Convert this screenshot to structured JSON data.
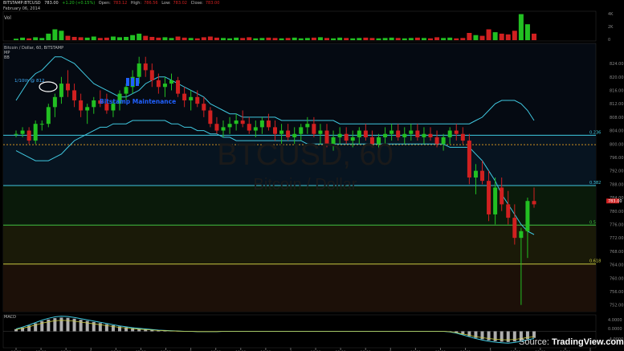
{
  "header": {
    "symbol": "BITSTAMP:BTCUSD",
    "last": "783.00",
    "change": "+1.20 (+0.15%)",
    "open_label": "Open:",
    "open": "783.12",
    "high_label": "High:",
    "high": "786.56",
    "low_label": "Low:",
    "low": "783.02",
    "close_label": "Close:",
    "close": "783.00",
    "date": "February 06, 2014"
  },
  "panes": {
    "vol_label": "Vol",
    "main_label": "Bitcoin / Dollar, 60, BITSTAMP",
    "mp_label": "MP",
    "bb_label": "BB",
    "macd_label": "MACD"
  },
  "watermark": {
    "line1": "BTCUSD, 60",
    "line2": "Bitcoin / Dollar"
  },
  "annotations": {
    "high_note": "1/10th @ 812",
    "maintenance": "Bitstamp Maintenance",
    "maintenance_icon": "bar-chart-icon"
  },
  "source": {
    "prefix": "Source:",
    "brand": "TradingView.com"
  },
  "colors": {
    "up": "#22c022",
    "down": "#d02020",
    "band": "#40c8e0",
    "macd": "#40c8e0",
    "signal": "#c8c840",
    "price_tag": "#d02020"
  },
  "chart_data": {
    "type": "candlestick",
    "x_axis_labels": [
      "06:00",
      "12:00",
      "18:00",
      "2",
      "06:00",
      "12:00",
      "18:00",
      "3",
      "06:00",
      "12:00",
      "18:00",
      "4",
      "06:00",
      "12:00",
      "18:00",
      "5",
      "06:00",
      "12:00",
      "18:00",
      "6",
      "06:00",
      "12:00",
      "18:00",
      "7"
    ],
    "price_axis": {
      "ylim": [
        750,
        830
      ],
      "tick_labels": [
        "824.00",
        "820.00",
        "816.00",
        "812.00",
        "808.00",
        "804.00",
        "800.00",
        "796.00",
        "792.00",
        "788.00",
        "784.00",
        "780.00",
        "776.00",
        "772.00",
        "768.00",
        "764.00",
        "760.00",
        "756.00",
        "752.00"
      ]
    },
    "last_price_label": "783.00",
    "fib_levels": [
      {
        "label": "0.236",
        "value": 802.6,
        "color": "#40c8e0"
      },
      {
        "label": "0.382",
        "value": 787.6,
        "color": "#40c8e0"
      },
      {
        "label": "0.5",
        "value": 775.8,
        "color": "#40c040"
      },
      {
        "label": "0.618",
        "value": 764.2,
        "color": "#c8c840"
      }
    ],
    "ma_line_value": 799.8,
    "volume_axis": {
      "tick_labels": [
        "4K",
        "2K",
        "0"
      ],
      "ylim": [
        0,
        4000
      ]
    },
    "macd_axis": {
      "tick_labels": [
        "4.0000",
        "0.0000",
        "-4.0000"
      ],
      "ylim": [
        -6,
        6
      ]
    },
    "candles": [
      [
        803,
        804,
        802,
        803
      ],
      [
        803,
        805,
        802,
        804
      ],
      [
        804,
        805,
        800,
        801
      ],
      [
        801,
        807,
        800,
        806
      ],
      [
        806,
        807,
        804,
        806
      ],
      [
        806,
        812,
        805,
        811
      ],
      [
        811,
        815,
        808,
        814
      ],
      [
        814,
        820,
        812,
        818
      ],
      [
        818,
        822,
        814,
        816
      ],
      [
        816,
        818,
        811,
        813
      ],
      [
        813,
        815,
        808,
        810
      ],
      [
        810,
        812,
        806,
        811
      ],
      [
        811,
        814,
        809,
        813
      ],
      [
        813,
        816,
        811,
        812
      ],
      [
        812,
        815,
        809,
        810
      ],
      [
        810,
        813,
        808,
        812
      ],
      [
        812,
        816,
        810,
        815
      ],
      [
        815,
        818,
        813,
        817
      ],
      [
        817,
        822,
        815,
        820
      ],
      [
        820,
        826,
        818,
        824
      ],
      [
        824,
        826,
        820,
        822
      ],
      [
        822,
        824,
        817,
        819
      ],
      [
        819,
        821,
        815,
        817
      ],
      [
        817,
        820,
        814,
        818
      ],
      [
        818,
        821,
        816,
        819
      ],
      [
        819,
        820,
        814,
        815
      ],
      [
        815,
        817,
        811,
        813
      ],
      [
        813,
        816,
        810,
        814
      ],
      [
        814,
        816,
        811,
        812
      ],
      [
        812,
        814,
        808,
        810
      ],
      [
        810,
        811,
        805,
        806
      ],
      [
        806,
        808,
        803,
        804
      ],
      [
        804,
        807,
        802,
        805
      ],
      [
        805,
        808,
        803,
        806
      ],
      [
        806,
        809,
        804,
        807
      ],
      [
        807,
        810,
        805,
        806
      ],
      [
        806,
        808,
        803,
        804
      ],
      [
        804,
        807,
        802,
        805
      ],
      [
        805,
        808,
        803,
        807
      ],
      [
        807,
        809,
        804,
        805
      ],
      [
        805,
        807,
        801,
        803
      ],
      [
        803,
        806,
        800,
        804
      ],
      [
        804,
        806,
        801,
        802
      ],
      [
        802,
        805,
        800,
        803
      ],
      [
        803,
        806,
        801,
        805
      ],
      [
        805,
        808,
        803,
        806
      ],
      [
        806,
        808,
        802,
        803
      ],
      [
        803,
        806,
        800,
        804
      ],
      [
        804,
        806,
        799,
        800
      ],
      [
        800,
        804,
        798,
        802
      ],
      [
        802,
        805,
        800,
        803
      ],
      [
        803,
        805,
        800,
        801
      ],
      [
        801,
        804,
        799,
        802
      ],
      [
        802,
        805,
        800,
        804
      ],
      [
        804,
        806,
        801,
        802
      ],
      [
        802,
        804,
        799,
        800
      ],
      [
        800,
        803,
        798,
        802
      ],
      [
        802,
        805,
        800,
        803
      ],
      [
        803,
        806,
        801,
        804
      ],
      [
        804,
        806,
        801,
        802
      ],
      [
        802,
        805,
        800,
        803
      ],
      [
        803,
        806,
        801,
        804
      ],
      [
        804,
        806,
        801,
        802
      ],
      [
        802,
        805,
        800,
        803
      ],
      [
        803,
        805,
        801,
        802
      ],
      [
        802,
        804,
        799,
        800
      ],
      [
        800,
        803,
        798,
        802
      ],
      [
        802,
        805,
        800,
        804
      ],
      [
        804,
        806,
        801,
        803
      ],
      [
        803,
        805,
        800,
        801
      ],
      [
        801,
        803,
        788,
        790
      ],
      [
        790,
        794,
        785,
        792
      ],
      [
        792,
        795,
        788,
        789
      ],
      [
        789,
        792,
        777,
        779
      ],
      [
        779,
        790,
        776,
        787
      ],
      [
        787,
        790,
        780,
        782
      ],
      [
        782,
        786,
        776,
        778
      ],
      [
        778,
        782,
        770,
        772
      ],
      [
        772,
        775,
        752,
        774
      ],
      [
        774,
        784,
        766,
        783
      ],
      [
        783,
        787,
        781,
        782
      ]
    ],
    "volume": [
      200,
      350,
      250,
      400,
      300,
      900,
      1500,
      1300,
      600,
      450,
      400,
      350,
      500,
      300,
      350,
      500,
      400,
      450,
      700,
      900,
      600,
      450,
      350,
      400,
      300,
      500,
      350,
      300,
      250,
      400,
      500,
      350,
      300,
      250,
      350,
      300,
      400,
      250,
      300,
      350,
      300,
      250,
      300,
      350,
      250,
      300,
      350,
      400,
      300,
      250,
      350,
      300,
      250,
      300,
      350,
      300,
      250,
      300,
      350,
      300,
      250,
      300,
      350,
      300,
      250,
      400,
      300,
      350,
      250,
      300,
      1000,
      700,
      600,
      1500,
      1100,
      900,
      800,
      1300,
      3600,
      2200,
      900
    ],
    "series": [
      {
        "name": "BB upper",
        "values": [
          813,
          816,
          819,
          821,
          822,
          824,
          826,
          826,
          825,
          824,
          822,
          820,
          818,
          817,
          816,
          815,
          814,
          814,
          815,
          816,
          818,
          819,
          820,
          820,
          819,
          818,
          817,
          816,
          815,
          814,
          812,
          811,
          810,
          809,
          809,
          808,
          808,
          808,
          808,
          808,
          808,
          807,
          807,
          807,
          807,
          807,
          807,
          807,
          807,
          807,
          806,
          806,
          806,
          806,
          806,
          806,
          806,
          806,
          806,
          806,
          806,
          806,
          806,
          806,
          806,
          806,
          806,
          806,
          806,
          806,
          806,
          807,
          808,
          810,
          812,
          813,
          813,
          813,
          812,
          810,
          807
        ]
      },
      {
        "name": "BB lower",
        "values": [
          798,
          797,
          796,
          795,
          795,
          795,
          796,
          797,
          799,
          801,
          802,
          803,
          804,
          805,
          805,
          806,
          806,
          806,
          807,
          807,
          807,
          807,
          807,
          807,
          806,
          806,
          805,
          805,
          804,
          804,
          803,
          803,
          802,
          802,
          801,
          801,
          801,
          801,
          801,
          801,
          801,
          801,
          801,
          801,
          801,
          800,
          800,
          800,
          800,
          800,
          800,
          800,
          800,
          800,
          800,
          800,
          800,
          800,
          800,
          800,
          800,
          800,
          800,
          800,
          800,
          800,
          800,
          799,
          799,
          799,
          799,
          797,
          795,
          792,
          789,
          785,
          782,
          779,
          776,
          774,
          773
        ]
      }
    ],
    "macd": [
      0.8,
      1.4,
      2.1,
      2.9,
      3.7,
      4.3,
      4.8,
      5.0,
      4.9,
      4.6,
      4.2,
      3.8,
      3.4,
      3.0,
      2.6,
      2.2,
      1.8,
      1.5,
      1.2,
      1.0,
      0.8,
      0.6,
      0.4,
      0.3,
      0.2,
      0.1,
      0.0,
      0.0,
      -0.1,
      -0.1,
      -0.1,
      -0.1,
      0.0,
      0.0,
      0.0,
      0.0,
      0.0,
      0.0,
      0.0,
      0.0,
      0.0,
      0.0,
      0.0,
      0.0,
      0.0,
      0.0,
      0.0,
      0.0,
      0.0,
      0.0,
      0.0,
      0.0,
      0.0,
      0.0,
      0.0,
      0.0,
      0.0,
      0.0,
      0.0,
      0.0,
      0.0,
      0.0,
      0.0,
      0.0,
      0.0,
      0.0,
      0.0,
      -0.2,
      -0.6,
      -1.2,
      -1.8,
      -2.4,
      -2.9,
      -3.3,
      -3.6,
      -3.8,
      -3.9,
      -3.7,
      -3.3,
      -2.8,
      -2.4
    ]
  }
}
